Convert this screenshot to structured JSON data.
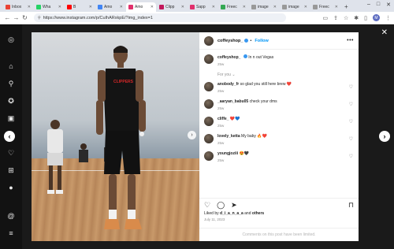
{
  "browser": {
    "tabs": [
      {
        "label": "Inbox",
        "color": "#ea4335"
      },
      {
        "label": "Wha",
        "color": "#25d366"
      },
      {
        "label": "B",
        "color": "#ff0000"
      },
      {
        "label": "Amo",
        "color": "#4285f4"
      },
      {
        "label": "Amo",
        "color": "#e1306c",
        "active": true
      },
      {
        "label": "Clipp",
        "color": "#c2185b"
      },
      {
        "label": "Sapp",
        "color": "#e1306c"
      },
      {
        "label": "Freec",
        "color": "#34a853"
      },
      {
        "label": "image",
        "color": "#999999"
      },
      {
        "label": "image",
        "color": "#999999"
      },
      {
        "label": "Freec",
        "color": "#999999"
      }
    ],
    "url": "https://www.instagram.com/p/CuIhARxkpE/?img_index=1",
    "profile_initial": "M"
  },
  "post": {
    "username": "coffeyshop_",
    "follow_label": "Follow",
    "caption": "In n out Vegas",
    "caption_time": "25w",
    "for_you_label": "For you",
    "comments": [
      {
        "user": "anobody_fr",
        "text": "so glad you still here brew ❤️",
        "time": "25w"
      },
      {
        "user": "_aaryan_babu05",
        "text": "check your dms",
        "time": "25w"
      },
      {
        "user": "cliffe_",
        "text": "❤️💙",
        "time": "25w"
      },
      {
        "user": "lovely_ketta",
        "text": "My baby 🔥❤️",
        "time": "25w"
      },
      {
        "user": "youngjoziii",
        "text": "😍🖤",
        "time": "25w"
      }
    ],
    "likes_prefix": "Liked by",
    "liked_by_user": "d_i_a_n_a_a",
    "likes_and": "and",
    "likes_others": "others",
    "date": "July 11, 2023",
    "comments_limited": "Comments on this post have been limited."
  }
}
